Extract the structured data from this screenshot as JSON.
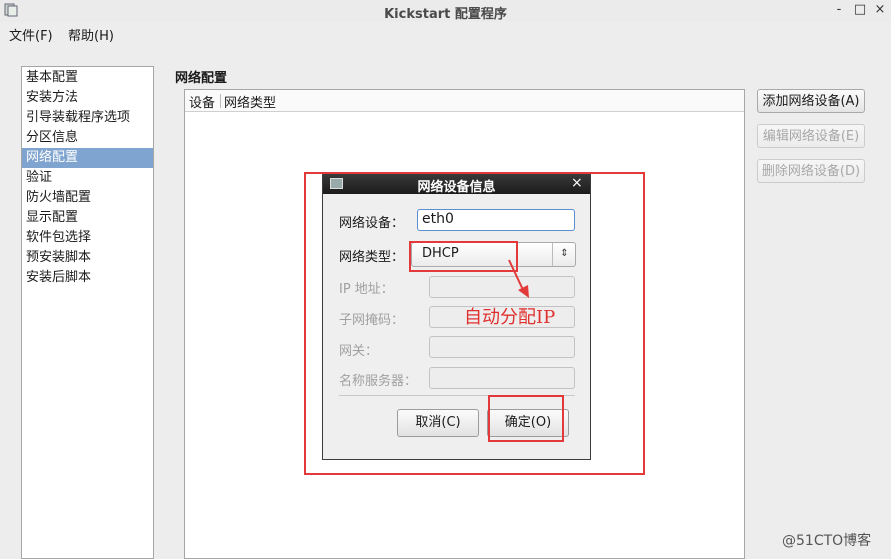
{
  "window": {
    "title": "Kickstart 配置程序",
    "controls": {
      "minimize": "-",
      "maximize": "□",
      "close": "×"
    }
  },
  "menubar": {
    "file": "文件(F)",
    "help": "帮助(H)"
  },
  "sidebar": {
    "items": [
      {
        "label": "基本配置",
        "selected": false
      },
      {
        "label": "安装方法",
        "selected": false
      },
      {
        "label": "引导装载程序选项",
        "selected": false
      },
      {
        "label": "分区信息",
        "selected": false
      },
      {
        "label": "网络配置",
        "selected": true
      },
      {
        "label": "验证",
        "selected": false
      },
      {
        "label": "防火墙配置",
        "selected": false
      },
      {
        "label": "显示配置",
        "selected": false
      },
      {
        "label": "软件包选择",
        "selected": false
      },
      {
        "label": "预安装脚本",
        "selected": false
      },
      {
        "label": "安装后脚本",
        "selected": false
      }
    ],
    "selected_color": "#7fa4cf"
  },
  "main": {
    "section_title": "网络配置",
    "table": {
      "columns": [
        "设备",
        "网络类型"
      ],
      "rows": []
    },
    "buttons": {
      "add": "添加网络设备(A)",
      "edit": "编辑网络设备(E)",
      "delete": "删除网络设备(D)"
    }
  },
  "dialog": {
    "title": "网络设备信息",
    "close": "×",
    "device_label": "网络设备：",
    "device_value": "eth0",
    "type_label": "网络类型：",
    "type_value": "DHCP",
    "type_arrow": "⇕",
    "ip_label": "IP 地址：",
    "netmask_label": "子网掩码：",
    "gateway_label": "网关：",
    "dns_label": "名称服务器：",
    "cancel_button": "取消(C)",
    "ok_button": "确定(O)"
  },
  "annotation": {
    "note": "自动分配IP",
    "color": "#e23a3a"
  },
  "watermark": "@51CTO博客"
}
